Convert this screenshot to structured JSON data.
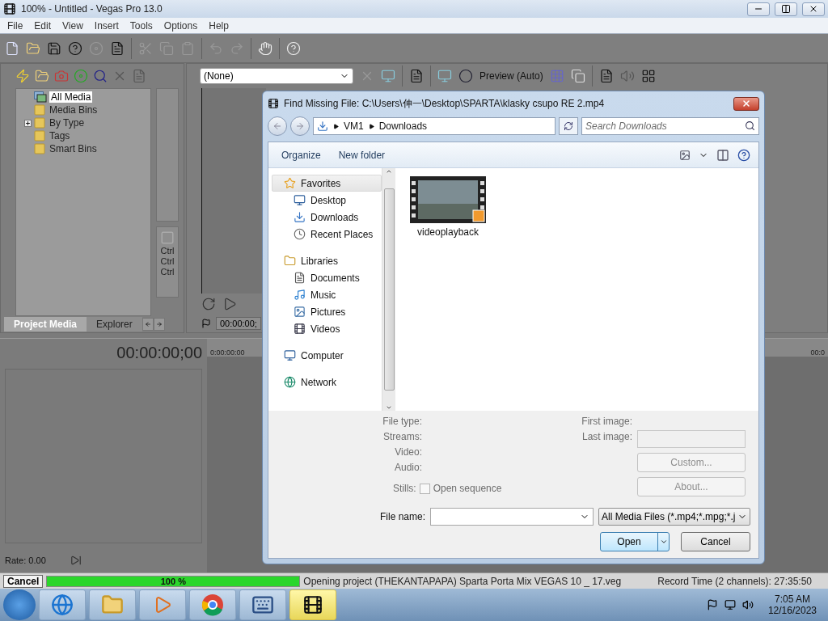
{
  "window": {
    "title": "100% - Untitled - Vegas Pro 13.0"
  },
  "menu": [
    "File",
    "Edit",
    "View",
    "Insert",
    "Tools",
    "Options",
    "Help"
  ],
  "project_media": {
    "tree": [
      {
        "label": "All Media",
        "selected": true,
        "kind": "all",
        "expandable": false
      },
      {
        "label": "Media Bins",
        "selected": false,
        "kind": "folder",
        "expandable": false
      },
      {
        "label": "By Type",
        "selected": false,
        "kind": "folder",
        "expandable": true
      },
      {
        "label": "Tags",
        "selected": false,
        "kind": "folder",
        "expandable": false
      },
      {
        "label": "Smart Bins",
        "selected": false,
        "kind": "folder",
        "expandable": false
      }
    ],
    "shortcuts": [
      "Ctrl",
      "Ctrl",
      "Ctrl"
    ],
    "tabs": [
      {
        "label": "Project Media",
        "selected": true
      },
      {
        "label": "Explorer",
        "selected": false
      }
    ]
  },
  "preview": {
    "source": "(None)",
    "quality": "Preview (Auto)",
    "time": "00:00:00;"
  },
  "timeline": {
    "time": "00:00:00;00",
    "ruler_start": "0:00:00:00",
    "ruler_end": "00:0",
    "rate": "Rate: 0.00"
  },
  "dialog": {
    "title": "Find Missing File: C:\\Users\\伸一\\Desktop\\SPARTA\\klasky csupo RE 2.mp4",
    "breadcrumb": [
      "VM1",
      "Downloads"
    ],
    "search": {
      "placeholder": "Search Downloads"
    },
    "commands": [
      "Organize",
      "New folder"
    ],
    "nav": [
      {
        "label": "Favorites",
        "kind": "favorites",
        "selected": true,
        "children": [
          {
            "label": "Desktop",
            "kind": "desktop",
            "selected": false
          },
          {
            "label": "Downloads",
            "kind": "downloads",
            "selected": false
          },
          {
            "label": "Recent Places",
            "kind": "recent",
            "selected": false
          }
        ]
      },
      {
        "label": "Libraries",
        "kind": "libraries",
        "selected": false,
        "children": [
          {
            "label": "Documents",
            "kind": "documents",
            "selected": false
          },
          {
            "label": "Music",
            "kind": "music",
            "selected": false
          },
          {
            "label": "Pictures",
            "kind": "pictures",
            "selected": false
          },
          {
            "label": "Videos",
            "kind": "videos",
            "selected": false
          }
        ]
      },
      {
        "label": "Computer",
        "kind": "computer",
        "selected": false
      },
      {
        "label": "Network",
        "kind": "network",
        "selected": false
      }
    ],
    "files": [
      {
        "name": "videoplayback",
        "kind": "video"
      }
    ],
    "details_left": [
      "File type:",
      "Streams:",
      "Video:",
      "Audio:"
    ],
    "stills": {
      "label": "Stills:",
      "option": "Open sequence",
      "checked": false
    },
    "details_right": [
      "First image:",
      "Last image:"
    ],
    "side_buttons": [
      {
        "label": "Custom...",
        "disabled": true
      },
      {
        "label": "About...",
        "disabled": true
      }
    ],
    "file_name": {
      "label": "File name:"
    },
    "file_type": "All Media Files (*.mp4;*.mpg;*.j",
    "open": "Open",
    "cancel": "Cancel"
  },
  "status": {
    "cancel": "Cancel",
    "progress": {
      "level": 1,
      "label": "100 %"
    },
    "message": "Opening project (THEKANTAPAPA) Sparta Porta Mix VEGAS 10 _ 17.veg",
    "record_time": "Record Time (2 channels): 27:35:50"
  },
  "taskbar": {
    "apps": [
      {
        "kind": "browser",
        "active": false
      },
      {
        "kind": "explorer",
        "active": false
      },
      {
        "kind": "player",
        "active": false
      },
      {
        "kind": "chrome",
        "active": false
      },
      {
        "kind": "keyboard",
        "active": false
      },
      {
        "kind": "vegas",
        "active": true
      }
    ],
    "time": "7:05 AM",
    "date": "12/16/2023"
  }
}
